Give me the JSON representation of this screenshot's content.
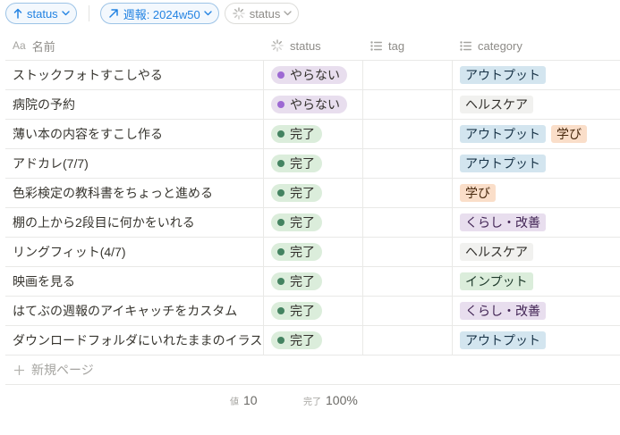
{
  "filters": {
    "sort": {
      "label": "status"
    },
    "week": {
      "label": "週報: 2024w50"
    },
    "status_filter": {
      "label": "status"
    }
  },
  "columns": {
    "name": "名前",
    "status": "status",
    "tag": "tag",
    "category": "category"
  },
  "status_styles": {
    "やらない": {
      "bg": "#e8deee",
      "dot": "#9d68d3"
    },
    "完了": {
      "bg": "#dbeddb",
      "dot": "#448361"
    }
  },
  "tag_styles": {
    "アウトプット": {
      "bg": "#d3e5ef",
      "fg": "#183347"
    },
    "ヘルスケア": {
      "bg": "#f1f1ef",
      "fg": "#32302c"
    },
    "学び": {
      "bg": "#fadec9",
      "fg": "#49290e"
    },
    "くらし・改善": {
      "bg": "#e8deee",
      "fg": "#412454"
    },
    "インプット": {
      "bg": "#dbeddb",
      "fg": "#1c3829"
    }
  },
  "rows": [
    {
      "name": "ストックフォトすこしやる",
      "status": "やらない",
      "tag": "",
      "category": [
        "アウトプット"
      ]
    },
    {
      "name": "病院の予約",
      "status": "やらない",
      "tag": "",
      "category": [
        "ヘルスケア"
      ]
    },
    {
      "name": "薄い本の内容をすこし作る",
      "status": "完了",
      "tag": "",
      "category": [
        "アウトプット",
        "学び"
      ]
    },
    {
      "name": "アドカレ(7/7)",
      "status": "完了",
      "tag": "",
      "category": [
        "アウトプット"
      ]
    },
    {
      "name": "色彩検定の教科書をちょっと進める",
      "status": "完了",
      "tag": "",
      "category": [
        "学び"
      ]
    },
    {
      "name": "棚の上から2段目に何かをいれる",
      "status": "完了",
      "tag": "",
      "category": [
        "くらし・改善"
      ]
    },
    {
      "name": "リングフィット(4/7)",
      "status": "完了",
      "tag": "",
      "category": [
        "ヘルスケア"
      ]
    },
    {
      "name": "映画を見る",
      "status": "完了",
      "tag": "",
      "category": [
        "インプット"
      ]
    },
    {
      "name": "はてぶの週報のアイキャッチをカスタム",
      "status": "完了",
      "tag": "",
      "category": [
        "くらし・改善"
      ]
    },
    {
      "name": "ダウンロードフォルダにいれたままのイラスト",
      "status": "完了",
      "tag": "",
      "category": [
        "アウトプット"
      ]
    }
  ],
  "new_page": "新規ページ",
  "footer": {
    "count_label": "値",
    "count_value": "10",
    "done_label": "完了",
    "done_value": "100%"
  }
}
